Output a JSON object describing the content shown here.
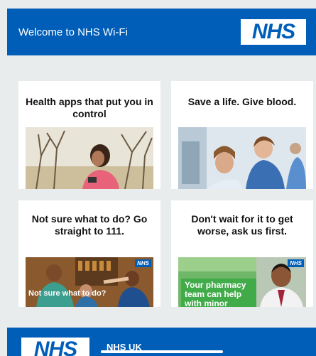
{
  "header": {
    "title": "Welcome to NHS Wi-Fi",
    "logo_text": "NHS"
  },
  "cards": [
    {
      "title": "Health apps that put you in control",
      "image": "woman-using-phone-outdoors"
    },
    {
      "title": "Save a life. Give blood.",
      "image": "nurse-with-blood-donor"
    },
    {
      "title": "Not sure what to do? Go straight to 111.",
      "image": "people-with-clinician-111",
      "overlay_text": "Not sure what to do?",
      "badge": "NHS"
    },
    {
      "title": "Don't wait for it to get worse, ask us first.",
      "image": "pharmacist-portrait",
      "overlay_text": "Your pharmacy team can help with minor",
      "badge": "NHS"
    }
  ],
  "footer": {
    "logo_text": "NHS",
    "link_text": "NHS UK"
  },
  "colors": {
    "nhs_blue": "#005eb8",
    "page_background": "#e8eced",
    "card_background": "#ffffff",
    "pharmacy_green": "#3caa46"
  }
}
